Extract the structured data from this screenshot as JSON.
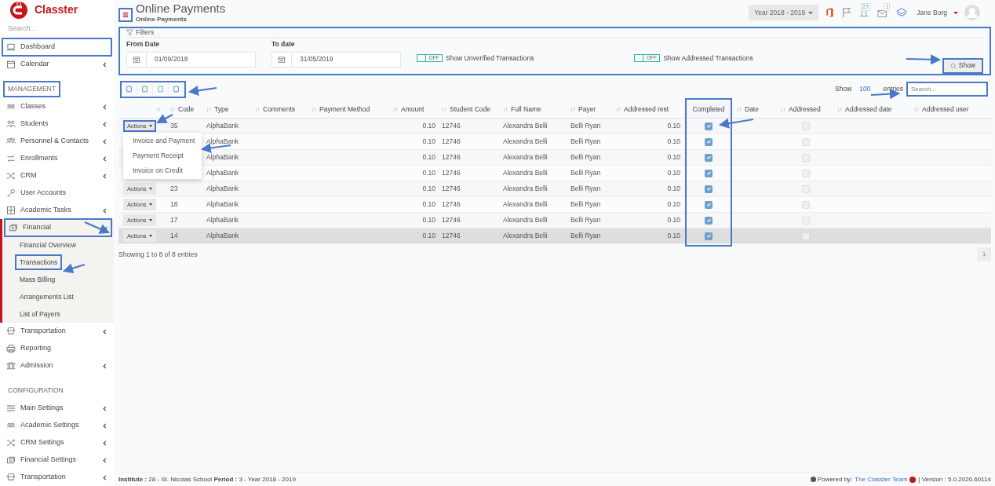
{
  "app": {
    "name": "Classter"
  },
  "sidebar": {
    "search": {
      "placeholder": "Search..."
    },
    "items": [
      {
        "kind": "item",
        "label": "Dashboard",
        "highlighted": true,
        "expandable": false
      },
      {
        "kind": "item",
        "label": "Calendar",
        "highlighted": false,
        "expandable": true
      },
      {
        "kind": "heading",
        "label": "MANAGEMENT",
        "highlighted": true
      },
      {
        "kind": "item",
        "label": "Classes",
        "highlighted": false,
        "expandable": true
      },
      {
        "kind": "item",
        "label": "Students",
        "highlighted": false,
        "expandable": true
      },
      {
        "kind": "item",
        "label": "Personnel & Contacts",
        "highlighted": false,
        "expandable": true
      },
      {
        "kind": "item",
        "label": "Enrollments",
        "highlighted": false,
        "expandable": true
      },
      {
        "kind": "item",
        "label": "CRM",
        "highlighted": false,
        "expandable": true
      },
      {
        "kind": "item",
        "label": "User Accounts",
        "highlighted": false,
        "expandable": false
      },
      {
        "kind": "item",
        "label": "Academic Tasks",
        "highlighted": false,
        "expandable": true
      },
      {
        "kind": "item",
        "label": "Financial",
        "highlighted": true,
        "expandable": true,
        "expanded": true,
        "children": [
          {
            "label": "Financial Overview",
            "highlighted": false
          },
          {
            "label": "Transactions",
            "highlighted": true
          },
          {
            "label": "Mass Billing",
            "highlighted": false
          },
          {
            "label": "Arrangements List",
            "highlighted": false
          },
          {
            "label": "List of Payers",
            "highlighted": false
          }
        ]
      },
      {
        "kind": "item",
        "label": "Transportation",
        "highlighted": false,
        "expandable": true
      },
      {
        "kind": "item",
        "label": "Reporting",
        "highlighted": false,
        "expandable": false
      },
      {
        "kind": "item",
        "label": "Admission",
        "highlighted": false,
        "expandable": true
      },
      {
        "kind": "heading",
        "label": "CONFIGURATION",
        "highlighted": false
      },
      {
        "kind": "item",
        "label": "Main Settings",
        "highlighted": false,
        "expandable": true
      },
      {
        "kind": "item",
        "label": "Academic Settings",
        "highlighted": false,
        "expandable": true
      },
      {
        "kind": "item",
        "label": "CRM Settings",
        "highlighted": false,
        "expandable": true
      },
      {
        "kind": "item",
        "label": "Financial Settings",
        "highlighted": false,
        "expandable": true
      },
      {
        "kind": "item",
        "label": "Transportation",
        "highlighted": false,
        "expandable": true
      }
    ]
  },
  "header": {
    "menu_highlighted": true,
    "title": "Online Payments",
    "subtitle": "Online Payments",
    "year": "Year 2018 - 2019",
    "notifications": "27",
    "messages": "1",
    "user": "Jane Borg"
  },
  "filters": {
    "title": "Filters",
    "highlighted": true,
    "from_date": {
      "label": "From Date",
      "value": "01/09/2018"
    },
    "to_date": {
      "label": "To date",
      "value": "31/05/2019"
    },
    "toggles": [
      {
        "state": "OFF",
        "on": false,
        "label": "Show Unverified Transactions"
      },
      {
        "state": "OFF",
        "on": false,
        "label": "Show Addressed Transactions"
      }
    ],
    "show_button": {
      "label": "Show",
      "highlighted": true
    }
  },
  "toolbar": {
    "highlighted": true
  },
  "table": {
    "show_label": "Show",
    "page_size": "100",
    "entries_label": "entries",
    "search": {
      "placeholder": "Search...",
      "highlighted": true
    },
    "columns": [
      {
        "highlighted": false
      },
      {
        "label": "Code",
        "highlighted": false
      },
      {
        "label": "Type",
        "highlighted": false
      },
      {
        "label": "Comments",
        "highlighted": false
      },
      {
        "label": "Payment Method",
        "highlighted": false
      },
      {
        "label": "Amount",
        "highlighted": false
      },
      {
        "label": "Student Code",
        "highlighted": false
      },
      {
        "label": "Full Name",
        "highlighted": false
      },
      {
        "label": "Payer",
        "highlighted": false
      },
      {
        "label": "Addressed rest",
        "highlighted": false
      },
      {
        "label": "Completed",
        "highlighted": true
      },
      {
        "label": "Date",
        "highlighted": false
      },
      {
        "label": "Addressed",
        "highlighted": false
      },
      {
        "label": "Addressed date",
        "highlighted": false
      },
      {
        "label": "Addressed user",
        "highlighted": false
      }
    ],
    "rows": [
      {
        "actions": "Actions",
        "actions_highlighted": true,
        "code": "35",
        "type": "AlphaBank",
        "amount": "0.10",
        "student_code": "12746",
        "full_name": "Alexandra Belli",
        "payer": "Belli Ryan",
        "addressed_rest": "0.10",
        "completed": true,
        "addressed": false,
        "hovered": false
      },
      {
        "type": "AlphaBank",
        "amount": "0.10",
        "student_code": "12746",
        "full_name": "Alexandra Belli",
        "payer": "Belli Ryan",
        "addressed_rest": "0.10",
        "completed": true,
        "addressed": false,
        "hovered": false
      },
      {
        "type": "AlphaBank",
        "amount": "0.10",
        "student_code": "12746",
        "full_name": "Alexandra Belli",
        "payer": "Belli Ryan",
        "addressed_rest": "0.10",
        "completed": true,
        "addressed": false,
        "hovered": false
      },
      {
        "type": "AlphaBank",
        "amount": "0.10",
        "student_code": "12746",
        "full_name": "Alexandra Belli",
        "payer": "Belli Ryan",
        "addressed_rest": "0.10",
        "completed": true,
        "addressed": false,
        "hovered": false
      },
      {
        "actions": "Actions",
        "actions_highlighted": false,
        "code": "23",
        "type": "AlphaBank",
        "amount": "0.10",
        "student_code": "12746",
        "full_name": "Alexandra Belli",
        "payer": "Belli Ryan",
        "addressed_rest": "0.10",
        "completed": true,
        "addressed": false,
        "hovered": false
      },
      {
        "actions": "Actions",
        "actions_highlighted": false,
        "code": "18",
        "type": "AlphaBank",
        "amount": "0.10",
        "student_code": "12746",
        "full_name": "Alexandra Belli",
        "payer": "Belli Ryan",
        "addressed_rest": "0.10",
        "completed": true,
        "addressed": false,
        "hovered": false
      },
      {
        "actions": "Actions",
        "actions_highlighted": false,
        "code": "17",
        "type": "AlphaBank",
        "amount": "0.10",
        "student_code": "12746",
        "full_name": "Alexandra Belli",
        "payer": "Belli Ryan",
        "addressed_rest": "0.10",
        "completed": true,
        "addressed": false,
        "hovered": false
      },
      {
        "actions": "Actions",
        "actions_highlighted": false,
        "code": "14",
        "type": "AlphaBank",
        "amount": "0.10",
        "student_code": "12746",
        "full_name": "Alexandra Belli",
        "payer": "Belli Ryan",
        "addressed_rest": "0.10",
        "completed": true,
        "addressed": false,
        "hovered": true
      }
    ],
    "actions_menu": [
      "Invoice and Payment",
      "Payment Receipt",
      "Invoice on Credit"
    ],
    "info": "Showing 1 to 8 of 8 entries",
    "pages": [
      {
        "label": "1",
        "selected": true
      }
    ]
  },
  "footer": {
    "info": "**Institute :** 28 - St. Nicolas School **Period :** 3 - Year 2018 - 2019",
    "powered_label": "Powered by:",
    "team": "The Classter Team",
    "version": "| Version : 5.0.2020.60114"
  }
}
